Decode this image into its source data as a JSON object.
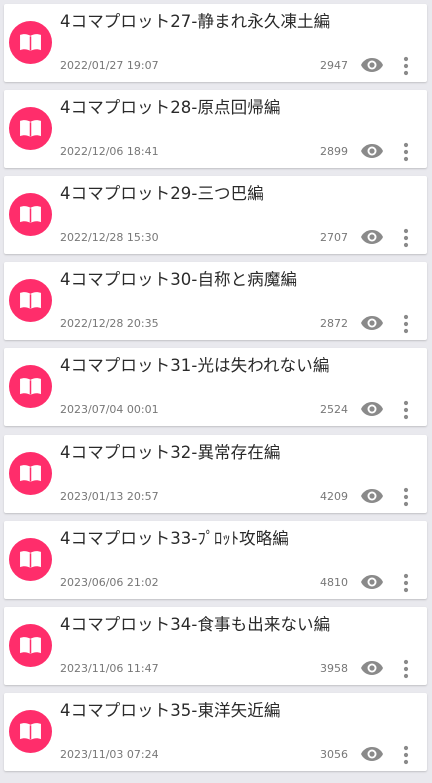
{
  "colors": {
    "accent": "#ff2d6b",
    "background": "#e9e9ee",
    "card": "#ffffff",
    "icon_gray": "#8a8a8a"
  },
  "icons": {
    "avatar": "book-icon",
    "views": "eye-icon",
    "more": "more-vert-icon"
  },
  "items": [
    {
      "title": "4コマプロット27-静まれ永久凍土編",
      "date": "2022/01/27 19:07",
      "views": "2947"
    },
    {
      "title": "4コマプロット28-原点回帰編",
      "date": "2022/12/06 18:41",
      "views": "2899"
    },
    {
      "title": "4コマプロット29-三つ巴編",
      "date": "2022/12/28 15:30",
      "views": "2707"
    },
    {
      "title": "4コマプロット30-自称と病魔編",
      "date": "2022/12/28 20:35",
      "views": "2872"
    },
    {
      "title": "4コマプロット31-光は失われない編",
      "date": "2023/07/04 00:01",
      "views": "2524"
    },
    {
      "title": "4コマプロット32-異常存在編",
      "date": "2023/01/13 20:57",
      "views": "4209"
    },
    {
      "title": "4コマプロット33-ﾌﾟﾛｯﾄ攻略編",
      "date": "2023/06/06 21:02",
      "views": "4810"
    },
    {
      "title": "4コマプロット34-食事も出来ない編",
      "date": "2023/11/06 11:47",
      "views": "3958"
    },
    {
      "title": "4コマプロット35-東洋矢近編",
      "date": "2023/11/03 07:24",
      "views": "3056"
    }
  ]
}
